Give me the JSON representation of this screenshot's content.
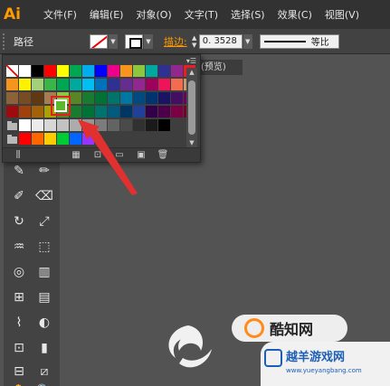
{
  "app": {
    "logo": "Ai"
  },
  "menu": [
    {
      "label": "文件(F)"
    },
    {
      "label": "编辑(E)"
    },
    {
      "label": "对象(O)"
    },
    {
      "label": "文字(T)"
    },
    {
      "label": "选择(S)"
    },
    {
      "label": "效果(C)"
    },
    {
      "label": "视图(V)"
    }
  ],
  "control_bar": {
    "selection_label": "路径",
    "stroke_label": "描边:",
    "stroke_weight": "0. 3528",
    "profile_label": "等比"
  },
  "document_tab": {
    "label": "(预览)"
  },
  "swatches": {
    "rows": [
      [
        "none",
        "#ffffff",
        "#000000",
        "#ff0000",
        "#ffff00",
        "#00a650",
        "#00aeef",
        "#0000ff",
        "#ec008c",
        "#f7941d",
        "#8dc63f",
        "#00a99d",
        "#2e3192",
        "#92278f",
        "#ed1c24"
      ],
      [
        "#f7941d",
        "#fff200",
        "#a3d17a",
        "#39b54a",
        "#00a651",
        "#00a99d",
        "#00bff3",
        "#0072bc",
        "#2e3192",
        "#662d91",
        "#92278f",
        "#9e005d",
        "#ed145b",
        "#f26c4f",
        "#c69c6d"
      ],
      [
        "#8c6239",
        "#754c24",
        "#603913",
        "#a67c52",
        "#8dc63f",
        "#598527",
        "#197b30",
        "#007236",
        "#00746b",
        "#0076a3",
        "#004a80",
        "#003471",
        "#1b1464",
        "#440e62",
        "#630460"
      ],
      [
        "#9e0b0f",
        "#a0410d",
        "#a36209",
        "#aba000",
        "#598527",
        "#1a7b30",
        "#007236",
        "#00746b",
        "#005b7f",
        "#003663",
        "#21409a",
        "#32004b",
        "#4b0049",
        "#7b0046",
        "#7a0026"
      ],
      [
        "#ffffff",
        "#ebebeb",
        "#d7d7d7",
        "#c2c2c2",
        "#acacac",
        "#959595",
        "#7c7c7c",
        "#636363",
        "#4a4a4a",
        "#313131",
        "#1a1a1a",
        "#000000"
      ],
      [
        "#ff0000",
        "#ff6600",
        "#ffcc00",
        "#00cc33",
        "#0066ff",
        "#9933ff"
      ]
    ],
    "selected": "#5cb82e"
  },
  "watermark": {
    "brand": "酷知网",
    "corner_title": "越羊游戏网",
    "corner_url": "www.yueyangbang.com"
  },
  "colors": {
    "accent": "#ff9a00",
    "highlight": "#e02020",
    "arrow": "#e03030"
  }
}
